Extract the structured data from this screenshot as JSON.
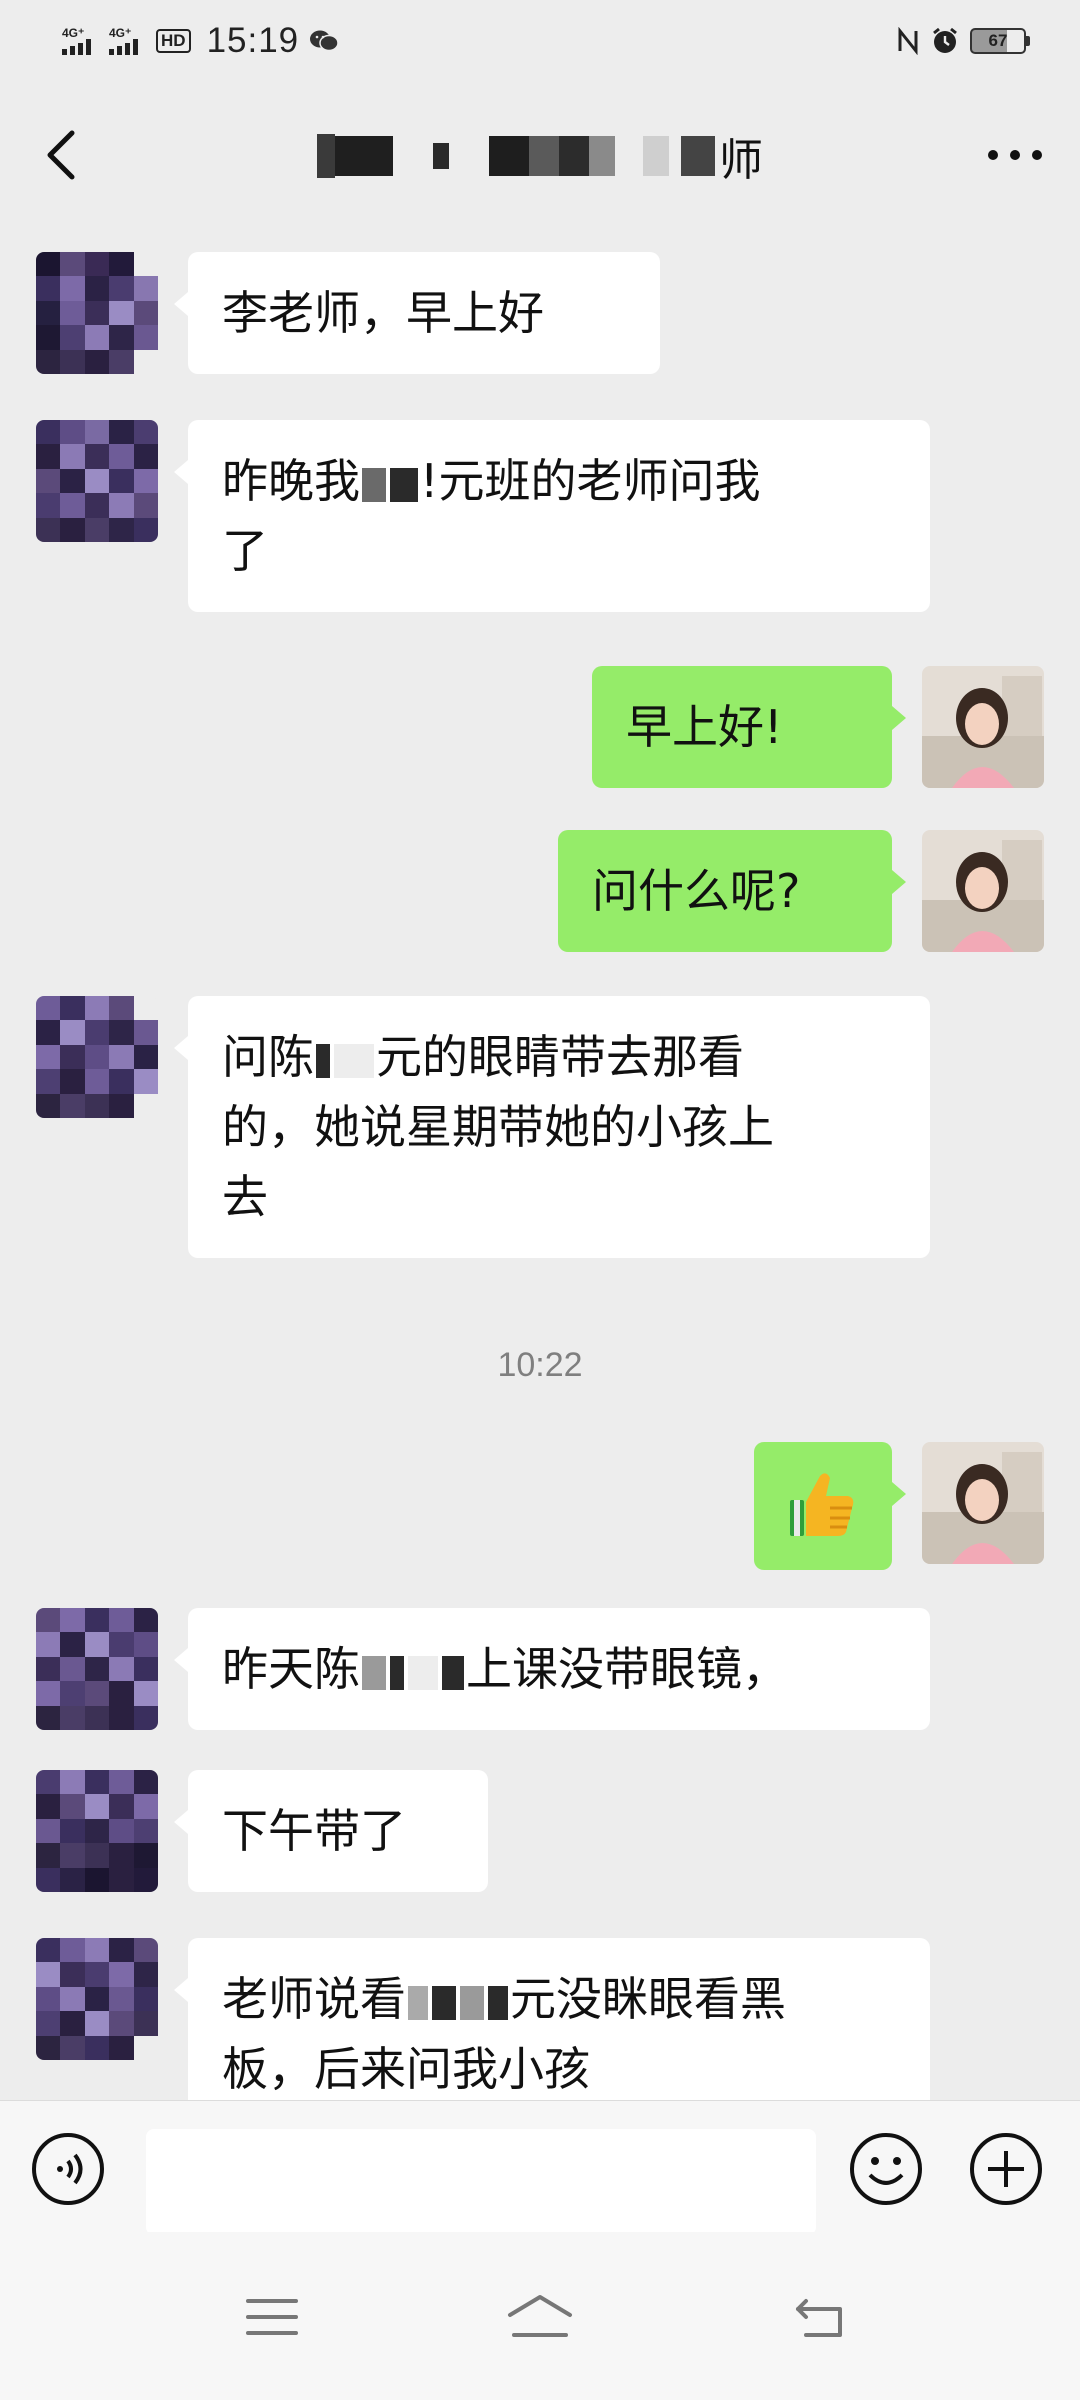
{
  "status_bar": {
    "network1": "4G⁺",
    "network2": "4G⁺",
    "hd_badge": "HD",
    "time": "15:19",
    "battery": "67"
  },
  "header": {
    "title_suffix": "师",
    "back_icon": "back-chevron-icon",
    "more_icon": "more-dots-icon"
  },
  "messages": [
    {
      "side": "in",
      "parts": [
        "李老师，早上好"
      ]
    },
    {
      "side": "in",
      "parts": [
        "昨晚我",
        "",
        "!",
        "元班的老师问我",
        "了"
      ]
    },
    {
      "side": "out",
      "text": "早上好!"
    },
    {
      "side": "out",
      "text": "问什么呢?"
    },
    {
      "side": "in",
      "parts": [
        "问陈",
        "",
        "元的眼睛带去那看",
        "的，她说星期带她的小孩上",
        "去"
      ]
    },
    {
      "side": "time",
      "text": "10:22"
    },
    {
      "side": "out",
      "emoji": "thumbs-up-icon"
    },
    {
      "side": "in",
      "parts": [
        "昨天陈",
        "",
        "上课没带眼镜，"
      ]
    },
    {
      "side": "in",
      "parts": [
        "下午带了"
      ]
    },
    {
      "side": "in",
      "parts": [
        "老师说看",
        "",
        "元没眯眼看黑",
        "板，后来问我小孩"
      ]
    }
  ],
  "input_bar": {
    "placeholder": "",
    "voice_icon": "voice-icon",
    "emoji_icon": "emoji-icon",
    "plus_icon": "plus-icon"
  },
  "nav_bar": {
    "menu_icon": "menu-icon",
    "home_icon": "home-icon",
    "back_icon": "nav-back-icon"
  },
  "colors": {
    "background": "#EDEDED",
    "incoming_bubble": "#FFFFFF",
    "outgoing_bubble": "#95EC69",
    "timestamp": "#7F7F7F"
  }
}
